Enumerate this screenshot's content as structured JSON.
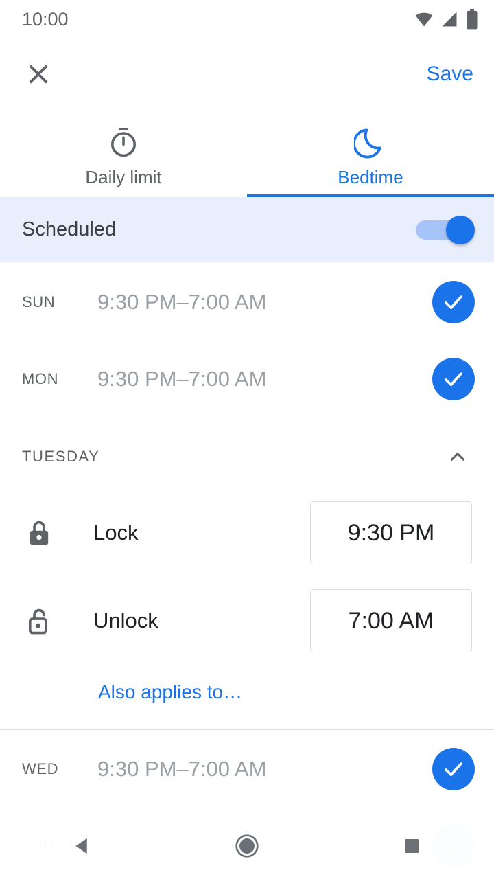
{
  "status_bar": {
    "time": "10:00",
    "icons": [
      "wifi-icon",
      "cellular-signal-icon",
      "battery-icon"
    ]
  },
  "app_bar": {
    "close_icon": "close-icon",
    "save_label": "Save"
  },
  "tabs": [
    {
      "label": "Daily limit",
      "icon": "timer-icon",
      "active": false
    },
    {
      "label": "Bedtime",
      "icon": "moon-icon",
      "active": true
    }
  ],
  "scheduled": {
    "label": "Scheduled",
    "toggle_on": true
  },
  "days": [
    {
      "abbr": "SUN",
      "range": "9:30 PM–7:00 AM",
      "checked": true
    },
    {
      "abbr": "MON",
      "range": "9:30 PM–7:00 AM",
      "checked": true
    },
    {
      "abbr": "WED",
      "range": "9:30 PM–7:00 AM",
      "checked": true
    },
    {
      "abbr": "THU",
      "range": "9 PM–7 AM",
      "checked": true
    }
  ],
  "expanded_day": {
    "title": "TUESDAY",
    "collapse_icon": "chevron-up-icon",
    "lock": {
      "icon": "lock-closed-icon",
      "label": "Lock",
      "time": "9:30 PM"
    },
    "unlock": {
      "icon": "lock-open-icon",
      "label": "Unlock",
      "time": "7:00 AM"
    },
    "also_applies_label": "Also applies to…"
  },
  "nav_bar": {
    "back_icon": "back-triangle-icon",
    "home_icon": "home-circle-icon",
    "recents_icon": "recents-square-icon"
  },
  "colors": {
    "accent": "#1a73e8",
    "scheduled_bg": "#e8eefc",
    "muted_text": "#9aa0a6",
    "secondary_text": "#5f6368",
    "primary_text": "#202124",
    "divider": "#dadce0"
  }
}
